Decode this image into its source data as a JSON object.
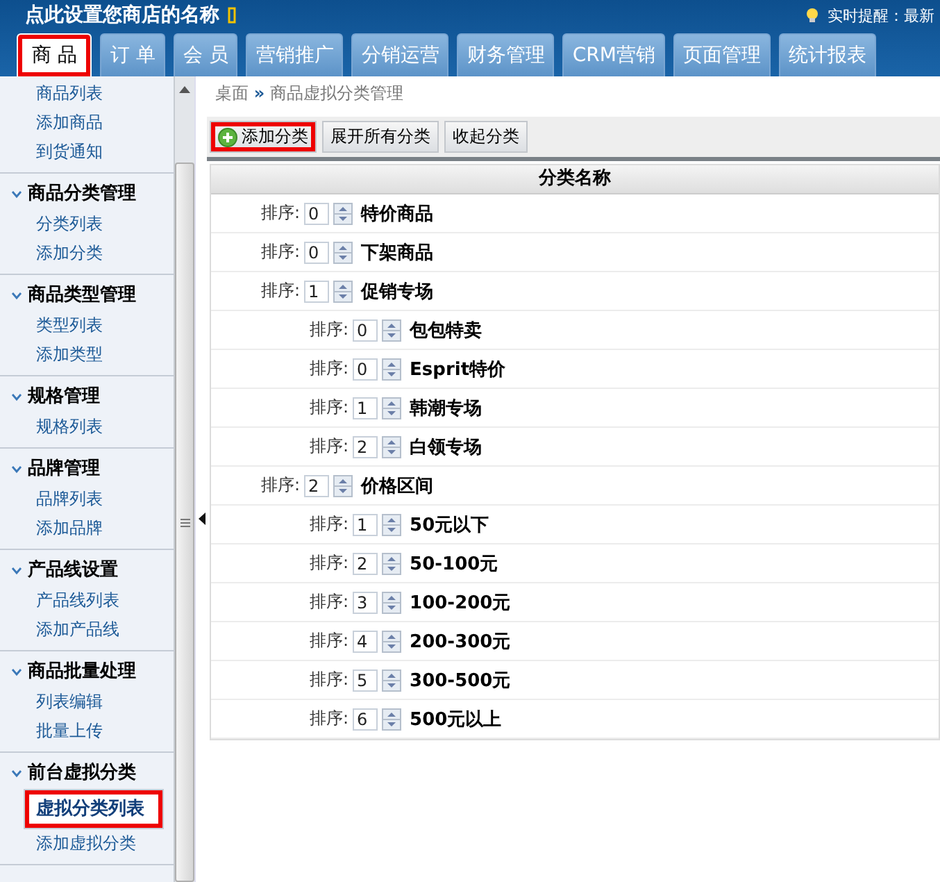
{
  "header": {
    "store_name": "点此设置您商店的名称",
    "notice": "实时提醒：最新"
  },
  "tabs": [
    {
      "label": "商 品",
      "selected": true,
      "highlighted": true
    },
    {
      "label": "订 单",
      "selected": false,
      "highlighted": false
    },
    {
      "label": "会 员",
      "selected": false,
      "highlighted": false
    },
    {
      "label": "营销推广",
      "selected": false,
      "highlighted": false
    },
    {
      "label": "分销运营",
      "selected": false,
      "highlighted": false
    },
    {
      "label": "财务管理",
      "selected": false,
      "highlighted": false
    },
    {
      "label": "CRM营销",
      "selected": false,
      "highlighted": false
    },
    {
      "label": "页面管理",
      "selected": false,
      "highlighted": false
    },
    {
      "label": "统计报表",
      "selected": false,
      "highlighted": false
    }
  ],
  "sidebar": {
    "groups": [
      {
        "items": [
          {
            "label": "商品列表",
            "selected": false,
            "highlighted": false
          },
          {
            "label": "添加商品",
            "selected": false,
            "highlighted": false
          },
          {
            "label": "到货通知",
            "selected": false,
            "highlighted": false
          }
        ]
      },
      {
        "title": "商品分类管理",
        "expanded": true,
        "items": [
          {
            "label": "分类列表",
            "selected": false,
            "highlighted": false
          },
          {
            "label": "添加分类",
            "selected": false,
            "highlighted": false
          }
        ]
      },
      {
        "title": "商品类型管理",
        "expanded": true,
        "items": [
          {
            "label": "类型列表",
            "selected": false,
            "highlighted": false
          },
          {
            "label": "添加类型",
            "selected": false,
            "highlighted": false
          }
        ]
      },
      {
        "title": "规格管理",
        "expanded": true,
        "items": [
          {
            "label": "规格列表",
            "selected": false,
            "highlighted": false
          }
        ]
      },
      {
        "title": "品牌管理",
        "expanded": true,
        "items": [
          {
            "label": "品牌列表",
            "selected": false,
            "highlighted": false
          },
          {
            "label": "添加品牌",
            "selected": false,
            "highlighted": false
          }
        ]
      },
      {
        "title": "产品线设置",
        "expanded": true,
        "items": [
          {
            "label": "产品线列表",
            "selected": false,
            "highlighted": false
          },
          {
            "label": "添加产品线",
            "selected": false,
            "highlighted": false
          }
        ]
      },
      {
        "title": "商品批量处理",
        "expanded": true,
        "items": [
          {
            "label": "列表编辑",
            "selected": false,
            "highlighted": false
          },
          {
            "label": "批量上传",
            "selected": false,
            "highlighted": false
          }
        ]
      },
      {
        "title": "前台虚拟分类",
        "expanded": true,
        "items": [
          {
            "label": "虚拟分类列表",
            "selected": true,
            "highlighted": true
          },
          {
            "label": "添加虚拟分类",
            "selected": false,
            "highlighted": false
          }
        ]
      }
    ]
  },
  "breadcrumb": {
    "home": "桌面",
    "separator": "»",
    "current": "商品虚拟分类管理"
  },
  "toolbar": [
    {
      "label": "添加分类",
      "kind": "add",
      "highlighted": true
    },
    {
      "label": "展开所有分类",
      "kind": "plain",
      "highlighted": false
    },
    {
      "label": "收起分类",
      "kind": "plain",
      "highlighted": false
    }
  ],
  "table": {
    "columns": [
      "分类名称"
    ],
    "rows": [
      {
        "sort_label": "排序:",
        "sort": "0",
        "name": "特价商品"
      },
      {
        "sort_label": "排序:",
        "sort": "0",
        "name": "下架商品"
      },
      {
        "sort_label": "排序:",
        "sort": "1",
        "name": "促销专场",
        "children": [
          {
            "sort_label": "排序:",
            "sort": "0",
            "name": "包包特卖"
          },
          {
            "sort_label": "排序:",
            "sort": "0",
            "name": "Esprit特价"
          },
          {
            "sort_label": "排序:",
            "sort": "1",
            "name": "韩潮专场"
          },
          {
            "sort_label": "排序:",
            "sort": "2",
            "name": "白领专场"
          }
        ]
      },
      {
        "sort_label": "排序:",
        "sort": "2",
        "name": "价格区间",
        "children": [
          {
            "sort_label": "排序:",
            "sort": "1",
            "name": "50元以下"
          },
          {
            "sort_label": "排序:",
            "sort": "2",
            "name": "50-100元"
          },
          {
            "sort_label": "排序:",
            "sort": "3",
            "name": "100-200元"
          },
          {
            "sort_label": "排序:",
            "sort": "4",
            "name": "200-300元"
          },
          {
            "sort_label": "排序:",
            "sort": "5",
            "name": "300-500元"
          },
          {
            "sort_label": "排序:",
            "sort": "6",
            "name": "500元以上"
          }
        ]
      }
    ]
  }
}
